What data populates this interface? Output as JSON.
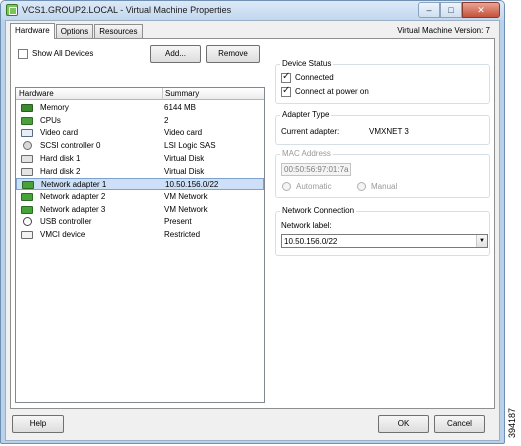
{
  "window": {
    "title": "VCS1.GROUP2.LOCAL - Virtual Machine Properties",
    "minimize_glyph": "–",
    "maximize_glyph": "□",
    "close_glyph": "✕"
  },
  "tabs": [
    {
      "label": "Hardware"
    },
    {
      "label": "Options"
    },
    {
      "label": "Resources"
    }
  ],
  "vm_version": "Virtual Machine Version: 7",
  "hardware_panel": {
    "show_all_devices_label": "Show All Devices",
    "show_all_devices_checked": false,
    "add_button": "Add...",
    "remove_button": "Remove",
    "columns": [
      "Hardware",
      "Summary"
    ],
    "selected_index": 6,
    "devices": [
      {
        "name": "Memory",
        "summary": "6144 MB",
        "icon": "memory-icon"
      },
      {
        "name": "CPUs",
        "summary": "2",
        "icon": "cpu-icon"
      },
      {
        "name": "Video card",
        "summary": "Video card",
        "icon": "monitor-icon"
      },
      {
        "name": "SCSI controller 0",
        "summary": "LSI Logic SAS",
        "icon": "disk-controller-icon"
      },
      {
        "name": "Hard disk 1",
        "summary": "Virtual Disk",
        "icon": "hard-disk-icon"
      },
      {
        "name": "Hard disk 2",
        "summary": "Virtual Disk",
        "icon": "hard-disk-icon"
      },
      {
        "name": "Network adapter 1",
        "summary": "10.50.156.0/22",
        "icon": "network-adapter-icon"
      },
      {
        "name": "Network adapter 2",
        "summary": "VM Network",
        "icon": "network-adapter-icon"
      },
      {
        "name": "Network adapter 3",
        "summary": "VM Network",
        "icon": "network-adapter-icon"
      },
      {
        "name": "USB controller",
        "summary": "Present",
        "icon": "usb-icon"
      },
      {
        "name": "VMCI device",
        "summary": "Restricted",
        "icon": "vmci-icon"
      }
    ]
  },
  "device_status": {
    "title": "Device Status",
    "connected_label": "Connected",
    "connected_checked": true,
    "connect_at_power_on_label": "Connect at power on",
    "connect_at_power_on_checked": true
  },
  "adapter_type": {
    "title": "Adapter Type",
    "current_adapter_label": "Current adapter:",
    "current_adapter_value": "VMXNET 3"
  },
  "mac_address": {
    "title": "MAC Address",
    "value": "00:50:56:97:01:7a",
    "automatic_label": "Automatic",
    "manual_label": "Manual"
  },
  "network_connection": {
    "title": "Network Connection",
    "network_label": "Network label:",
    "selected_value": "10.50.156.0/22"
  },
  "footer": {
    "help_button": "Help",
    "ok_button": "OK",
    "cancel_button": "Cancel"
  },
  "side_label": "394187",
  "colors": {
    "selection_bg": "#cde0f7",
    "selection_border": "#7da2ce",
    "window_frame": "#b9d1ea",
    "close_button": "#c4523b"
  }
}
